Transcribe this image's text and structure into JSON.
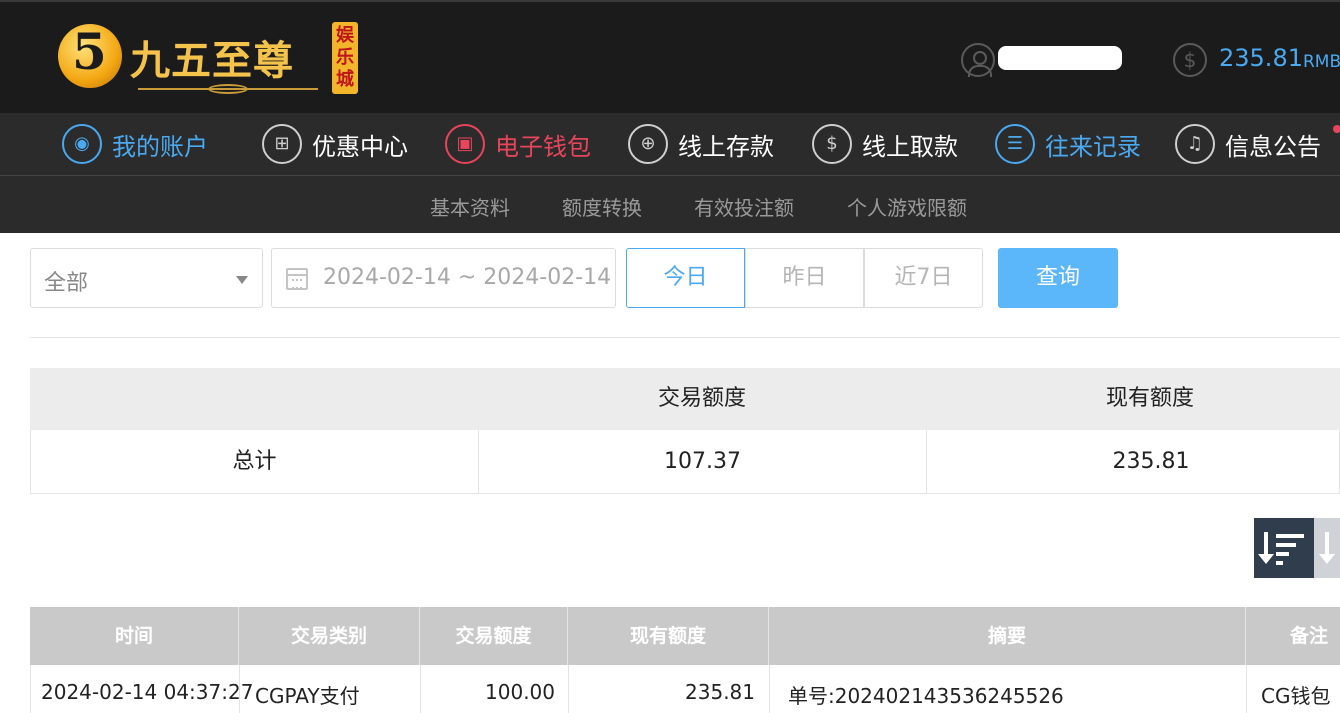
{
  "header": {
    "logo_title": "九五至尊",
    "logo_sub": "娱乐城",
    "balance": "235.81",
    "balance_unit": "RMB"
  },
  "nav": {
    "items": [
      {
        "label": "我的账户"
      },
      {
        "label": "优惠中心"
      },
      {
        "label": "电子钱包"
      },
      {
        "label": "线上存款"
      },
      {
        "label": "线上取款"
      },
      {
        "label": "往来记录"
      },
      {
        "label": "信息公告"
      }
    ]
  },
  "subnav": {
    "items": [
      {
        "label": "基本资料"
      },
      {
        "label": "额度转换"
      },
      {
        "label": "有效投注额"
      },
      {
        "label": "个人游戏限额"
      }
    ]
  },
  "filter": {
    "type_value": "全部",
    "date_range": "2024-02-14 ~ 2024-02-14",
    "quick": [
      "今日",
      "昨日",
      "近7日"
    ],
    "query_label": "查询"
  },
  "summary": {
    "headers": [
      "交易额度",
      "现有额度"
    ],
    "row_label": "总计",
    "transaction_amount": "107.37",
    "current_amount": "235.81"
  },
  "records": {
    "headers": [
      "时间",
      "交易类别",
      "交易额度",
      "现有额度",
      "摘要",
      "备注"
    ],
    "rows": [
      {
        "time": "2024-02-14 04:37:27",
        "type": "CGPAY支付",
        "amount": "100.00",
        "balance": "235.81",
        "summary": "单号:202402143536245526",
        "note": "CG钱包"
      }
    ]
  },
  "colors": {
    "accent_blue": "#4aa9f0",
    "accent_red": "#e8455b",
    "header_bg": "#1b1b1b",
    "nav_bg": "#2b2b2b",
    "query_button": "#5bb6fa"
  }
}
